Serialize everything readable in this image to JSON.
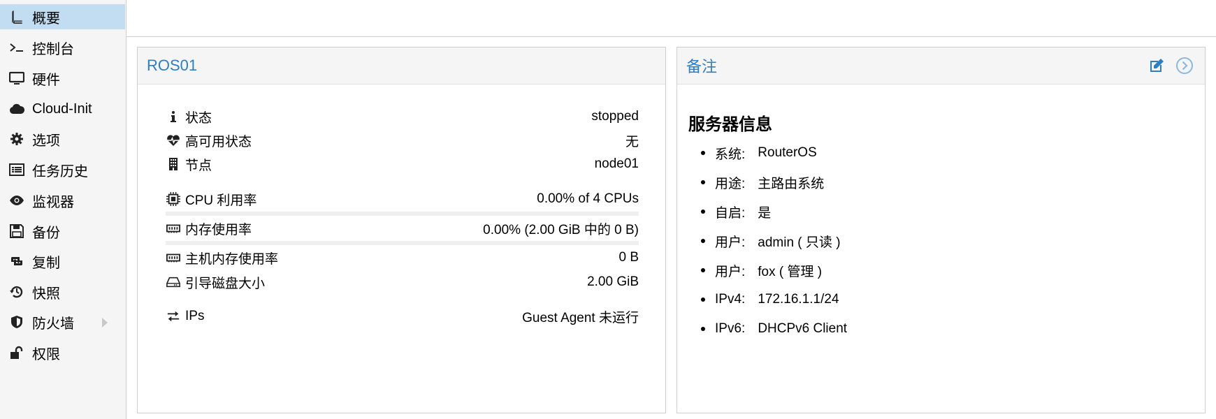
{
  "sidebar": {
    "items": [
      {
        "label": "概要",
        "icon": "book-icon",
        "active": true
      },
      {
        "label": "控制台",
        "icon": "terminal-icon"
      },
      {
        "label": "硬件",
        "icon": "monitor-icon"
      },
      {
        "label": "Cloud-Init",
        "icon": "cloud-icon"
      },
      {
        "label": "选项",
        "icon": "gear-icon"
      },
      {
        "label": "任务历史",
        "icon": "list-icon"
      },
      {
        "label": "监视器",
        "icon": "eye-icon"
      },
      {
        "label": "备份",
        "icon": "floppy-icon"
      },
      {
        "label": "复制",
        "icon": "retweet-icon"
      },
      {
        "label": "快照",
        "icon": "history-icon"
      },
      {
        "label": "防火墙",
        "icon": "shield-icon",
        "has_submenu": true
      },
      {
        "label": "权限",
        "icon": "unlock-icon"
      }
    ]
  },
  "status_panel": {
    "title": "ROS01",
    "rows": [
      {
        "label": "状态",
        "value": "stopped",
        "icon": "info-icon"
      },
      {
        "label": "高可用状态",
        "value": "无",
        "icon": "heartbeat-icon"
      },
      {
        "label": "节点",
        "value": "node01",
        "icon": "building-icon"
      },
      {
        "label": "CPU 利用率",
        "value": "0.00% of 4 CPUs",
        "icon": "cpu-icon",
        "usage": 0.0
      },
      {
        "label": "内存使用率",
        "value": "0.00% (2.00 GiB 中的 0 B)",
        "icon": "memory-icon",
        "usage": 0.0
      },
      {
        "label": "主机内存使用率",
        "value": "0 B",
        "icon": "memory-icon"
      },
      {
        "label": "引导磁盘大小",
        "value": "2.00 GiB",
        "icon": "hdd-icon"
      },
      {
        "label": "IPs",
        "value": "Guest Agent 未运行",
        "icon": "exchange-icon"
      }
    ]
  },
  "notes_panel": {
    "title": "备注",
    "heading": "服务器信息",
    "items": [
      {
        "key": "系统:",
        "value": "RouterOS"
      },
      {
        "key": "用途:",
        "value": "主路由系统"
      },
      {
        "key": "自启:",
        "value": "是"
      },
      {
        "key": "用户:",
        "value": "admin ( 只读 )"
      },
      {
        "key": "用户:",
        "value": "fox ( 管理 )"
      },
      {
        "key": "IPv4:",
        "value": "172.16.1.1/24"
      },
      {
        "key": "IPv6:",
        "value": "DHCPv6 Client"
      }
    ]
  },
  "colors": {
    "accent": "#2b7fc2",
    "active_nav": "#c2ddf2",
    "sidebar_bg": "#f5f5f5"
  }
}
